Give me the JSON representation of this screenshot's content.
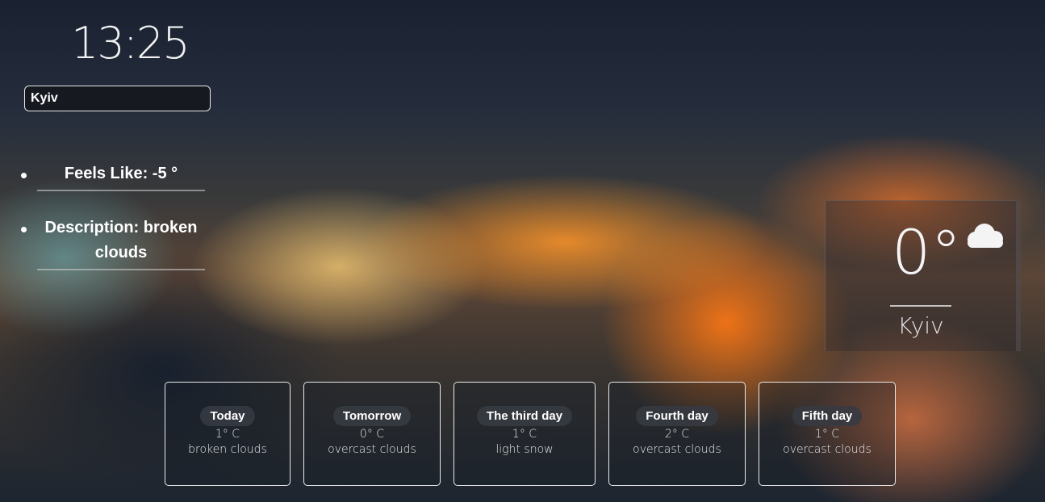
{
  "clock": {
    "time": "13:25"
  },
  "search": {
    "value": "Kyiv"
  },
  "details": [
    {
      "text": "Feels Like: -5 °"
    },
    {
      "text": "Description: broken clouds"
    }
  ],
  "current": {
    "temperature": "0°",
    "city": "Kyiv",
    "icon": "cloud-icon"
  },
  "forecast": [
    {
      "day": "Today",
      "temp": "1° C",
      "desc": "broken clouds"
    },
    {
      "day": "Tomorrow",
      "temp": "0° C",
      "desc": "overcast clouds"
    },
    {
      "day": "The third day",
      "temp": "1° C",
      "desc": "light snow"
    },
    {
      "day": "Fourth day",
      "temp": "2° C",
      "desc": "overcast clouds"
    },
    {
      "day": "Fifth day",
      "temp": "1° C",
      "desc": "overcast clouds"
    }
  ]
}
